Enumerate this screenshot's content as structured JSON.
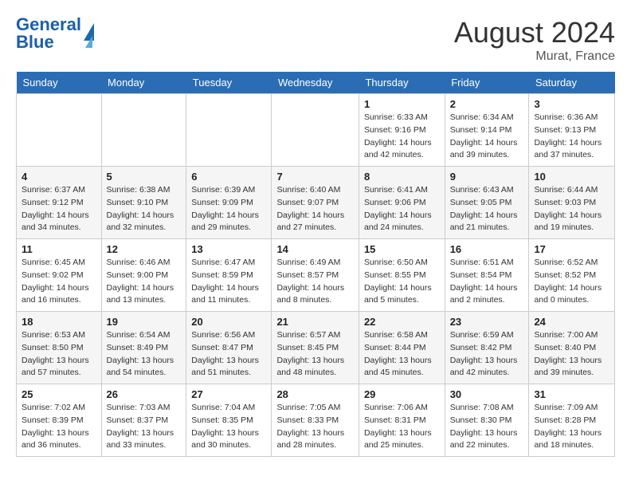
{
  "header": {
    "logo_text1": "General",
    "logo_text2": "Blue",
    "month": "August 2024",
    "location": "Murat, France"
  },
  "days_of_week": [
    "Sunday",
    "Monday",
    "Tuesday",
    "Wednesday",
    "Thursday",
    "Friday",
    "Saturday"
  ],
  "weeks": [
    [
      {
        "day": "",
        "info": ""
      },
      {
        "day": "",
        "info": ""
      },
      {
        "day": "",
        "info": ""
      },
      {
        "day": "",
        "info": ""
      },
      {
        "day": "1",
        "info": "Sunrise: 6:33 AM\nSunset: 9:16 PM\nDaylight: 14 hours\nand 42 minutes."
      },
      {
        "day": "2",
        "info": "Sunrise: 6:34 AM\nSunset: 9:14 PM\nDaylight: 14 hours\nand 39 minutes."
      },
      {
        "day": "3",
        "info": "Sunrise: 6:36 AM\nSunset: 9:13 PM\nDaylight: 14 hours\nand 37 minutes."
      }
    ],
    [
      {
        "day": "4",
        "info": "Sunrise: 6:37 AM\nSunset: 9:12 PM\nDaylight: 14 hours\nand 34 minutes."
      },
      {
        "day": "5",
        "info": "Sunrise: 6:38 AM\nSunset: 9:10 PM\nDaylight: 14 hours\nand 32 minutes."
      },
      {
        "day": "6",
        "info": "Sunrise: 6:39 AM\nSunset: 9:09 PM\nDaylight: 14 hours\nand 29 minutes."
      },
      {
        "day": "7",
        "info": "Sunrise: 6:40 AM\nSunset: 9:07 PM\nDaylight: 14 hours\nand 27 minutes."
      },
      {
        "day": "8",
        "info": "Sunrise: 6:41 AM\nSunset: 9:06 PM\nDaylight: 14 hours\nand 24 minutes."
      },
      {
        "day": "9",
        "info": "Sunrise: 6:43 AM\nSunset: 9:05 PM\nDaylight: 14 hours\nand 21 minutes."
      },
      {
        "day": "10",
        "info": "Sunrise: 6:44 AM\nSunset: 9:03 PM\nDaylight: 14 hours\nand 19 minutes."
      }
    ],
    [
      {
        "day": "11",
        "info": "Sunrise: 6:45 AM\nSunset: 9:02 PM\nDaylight: 14 hours\nand 16 minutes."
      },
      {
        "day": "12",
        "info": "Sunrise: 6:46 AM\nSunset: 9:00 PM\nDaylight: 14 hours\nand 13 minutes."
      },
      {
        "day": "13",
        "info": "Sunrise: 6:47 AM\nSunset: 8:59 PM\nDaylight: 14 hours\nand 11 minutes."
      },
      {
        "day": "14",
        "info": "Sunrise: 6:49 AM\nSunset: 8:57 PM\nDaylight: 14 hours\nand 8 minutes."
      },
      {
        "day": "15",
        "info": "Sunrise: 6:50 AM\nSunset: 8:55 PM\nDaylight: 14 hours\nand 5 minutes."
      },
      {
        "day": "16",
        "info": "Sunrise: 6:51 AM\nSunset: 8:54 PM\nDaylight: 14 hours\nand 2 minutes."
      },
      {
        "day": "17",
        "info": "Sunrise: 6:52 AM\nSunset: 8:52 PM\nDaylight: 14 hours\nand 0 minutes."
      }
    ],
    [
      {
        "day": "18",
        "info": "Sunrise: 6:53 AM\nSunset: 8:50 PM\nDaylight: 13 hours\nand 57 minutes."
      },
      {
        "day": "19",
        "info": "Sunrise: 6:54 AM\nSunset: 8:49 PM\nDaylight: 13 hours\nand 54 minutes."
      },
      {
        "day": "20",
        "info": "Sunrise: 6:56 AM\nSunset: 8:47 PM\nDaylight: 13 hours\nand 51 minutes."
      },
      {
        "day": "21",
        "info": "Sunrise: 6:57 AM\nSunset: 8:45 PM\nDaylight: 13 hours\nand 48 minutes."
      },
      {
        "day": "22",
        "info": "Sunrise: 6:58 AM\nSunset: 8:44 PM\nDaylight: 13 hours\nand 45 minutes."
      },
      {
        "day": "23",
        "info": "Sunrise: 6:59 AM\nSunset: 8:42 PM\nDaylight: 13 hours\nand 42 minutes."
      },
      {
        "day": "24",
        "info": "Sunrise: 7:00 AM\nSunset: 8:40 PM\nDaylight: 13 hours\nand 39 minutes."
      }
    ],
    [
      {
        "day": "25",
        "info": "Sunrise: 7:02 AM\nSunset: 8:39 PM\nDaylight: 13 hours\nand 36 minutes."
      },
      {
        "day": "26",
        "info": "Sunrise: 7:03 AM\nSunset: 8:37 PM\nDaylight: 13 hours\nand 33 minutes."
      },
      {
        "day": "27",
        "info": "Sunrise: 7:04 AM\nSunset: 8:35 PM\nDaylight: 13 hours\nand 30 minutes."
      },
      {
        "day": "28",
        "info": "Sunrise: 7:05 AM\nSunset: 8:33 PM\nDaylight: 13 hours\nand 28 minutes."
      },
      {
        "day": "29",
        "info": "Sunrise: 7:06 AM\nSunset: 8:31 PM\nDaylight: 13 hours\nand 25 minutes."
      },
      {
        "day": "30",
        "info": "Sunrise: 7:08 AM\nSunset: 8:30 PM\nDaylight: 13 hours\nand 22 minutes."
      },
      {
        "day": "31",
        "info": "Sunrise: 7:09 AM\nSunset: 8:28 PM\nDaylight: 13 hours\nand 18 minutes."
      }
    ]
  ]
}
